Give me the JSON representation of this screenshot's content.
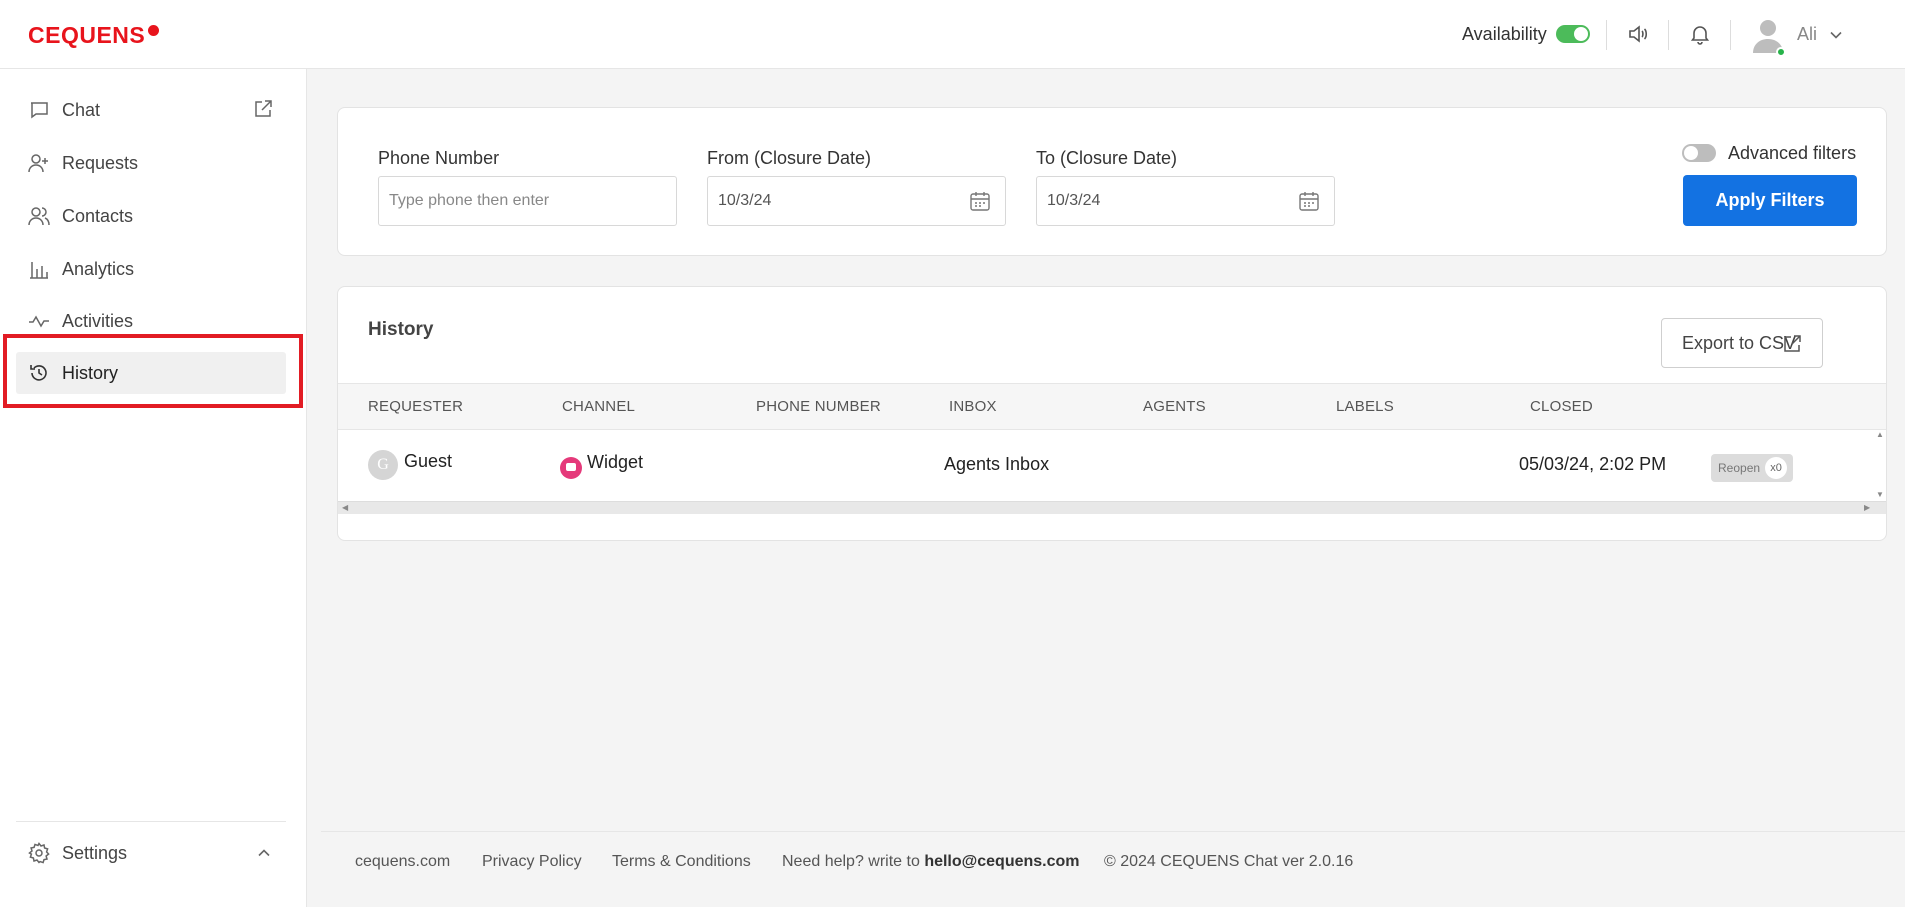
{
  "brand": {
    "logo_text": "CEQUENS"
  },
  "header": {
    "availability_label": "Availability",
    "availability_on": true,
    "user_name": "Ali"
  },
  "sidebar": {
    "items": [
      {
        "label": "Chat",
        "icon": "chat-icon"
      },
      {
        "label": "Requests",
        "icon": "user-plus-icon"
      },
      {
        "label": "Contacts",
        "icon": "contacts-icon"
      },
      {
        "label": "Analytics",
        "icon": "bar-chart-icon"
      },
      {
        "label": "Activities",
        "icon": "activity-icon"
      },
      {
        "label": "History",
        "icon": "history-icon",
        "active": true
      }
    ],
    "settings_label": "Settings"
  },
  "filters": {
    "phone_label": "Phone Number",
    "phone_placeholder": "Type phone then enter",
    "from_label": "From (Closure Date)",
    "from_value": "10/3/24",
    "to_label": "To (Closure Date)",
    "to_value": "10/3/24",
    "advanced_label": "Advanced filters",
    "advanced_on": false,
    "apply_label": "Apply Filters"
  },
  "history": {
    "title": "History",
    "export_label": "Export to CSV",
    "columns": [
      "REQUESTER",
      "CHANNEL",
      "PHONE NUMBER",
      "INBOX",
      "AGENTS",
      "LABELS",
      "CLOSED"
    ],
    "rows": [
      {
        "requester_initial": "G",
        "requester": "Guest",
        "channel": "Widget",
        "phone": "",
        "inbox": "Agents Inbox",
        "agents": "",
        "labels": "",
        "closed": "05/03/24, 2:02 PM",
        "reopen_label": "Reopen",
        "reopen_count": "x0"
      }
    ]
  },
  "footer": {
    "site": "cequens.com",
    "privacy": "Privacy Policy",
    "terms": "Terms & Conditions",
    "help_prefix": "Need help? write to",
    "help_email": "hello@cequens.com",
    "copyright": "© 2024 CEQUENS Chat ver 2.0.16"
  },
  "colors": {
    "brand_red": "#e8141c",
    "primary_blue": "#1372e2",
    "toggle_green": "#4cbb5a",
    "highlight_red": "#e21c24"
  }
}
